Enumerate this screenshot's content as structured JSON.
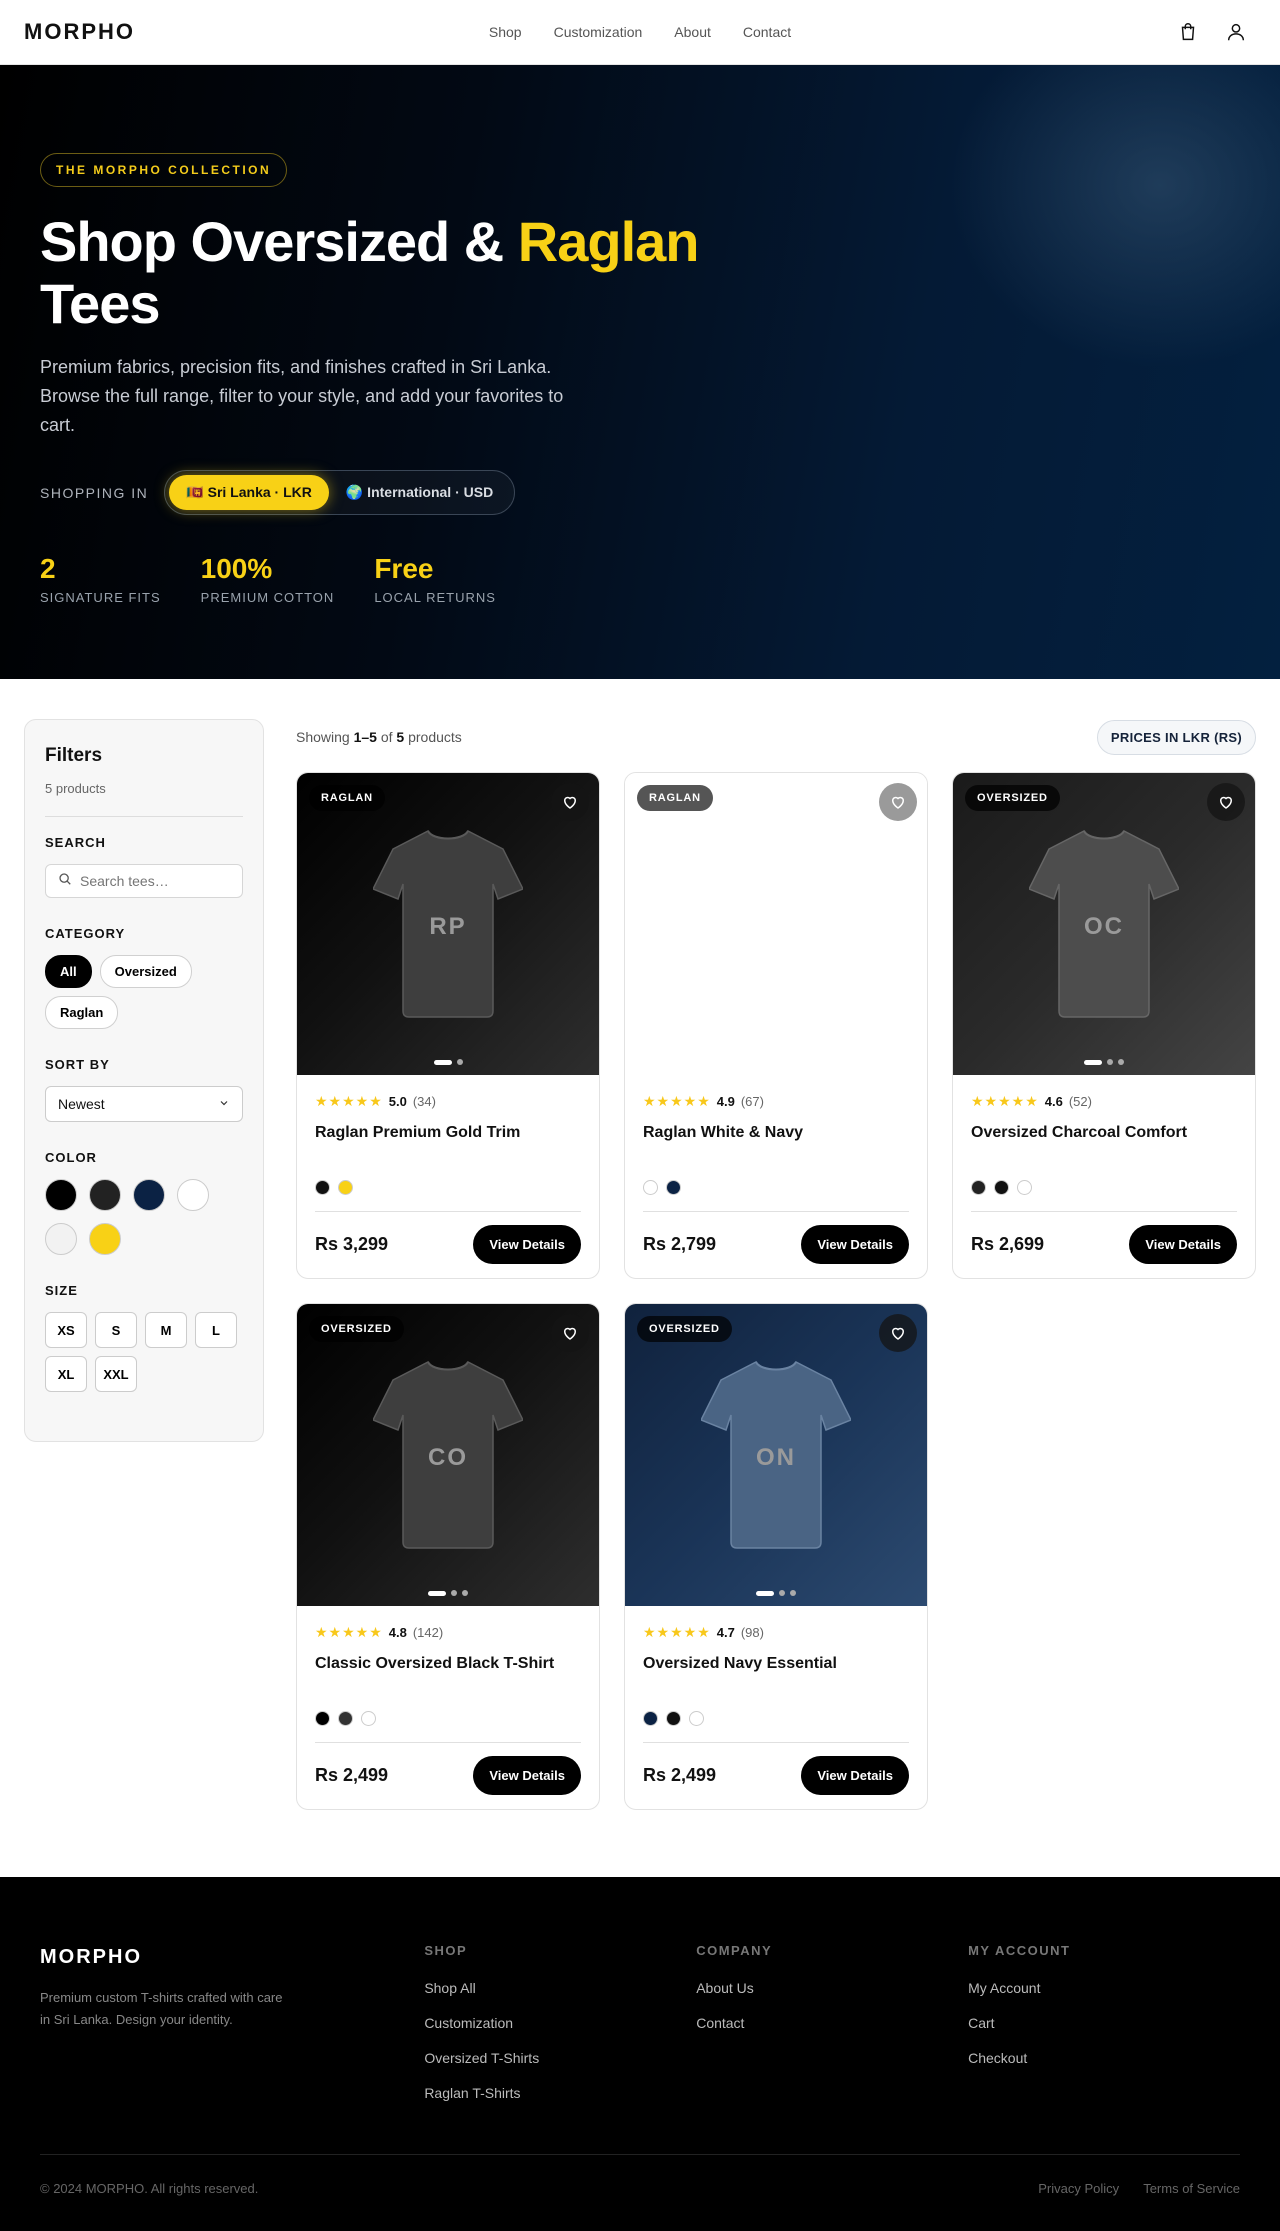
{
  "nav": {
    "logo": "MORPHO",
    "links": [
      "Shop",
      "Customization",
      "About",
      "Contact"
    ],
    "icons": [
      "cart-icon",
      "user-icon"
    ]
  },
  "hero": {
    "pill": "THE MORPHO COLLECTION",
    "title_line1": "Shop Oversized & ",
    "title_highlight": "Raglan",
    "title_line2": "Tees",
    "description": "Premium fabrics, precision fits, and finishes crafted in Sri Lanka. Browse the full range, filter to your style, and add your favorites to cart.",
    "shopping_in_label": "SHOPPING IN",
    "region_options": [
      "🇱🇰 Sri Lanka · LKR",
      "🌍 International · USD"
    ],
    "region_selected": "🇱🇰 Sri Lanka · LKR",
    "stats": [
      {
        "value": "2",
        "label": "SIGNATURE FITS"
      },
      {
        "value": "100%",
        "label": "PREMIUM COTTON"
      },
      {
        "value": "Free",
        "label": "LOCAL RETURNS"
      }
    ],
    "accent_color": "#f8d116"
  },
  "filters": {
    "title": "Filters",
    "count_text": "5 products",
    "search_label": "SEARCH",
    "search_placeholder": "Search tees…",
    "category_label": "CATEGORY",
    "categories": [
      "All",
      "Oversized",
      "Raglan"
    ],
    "category_selected": "All",
    "sort_label": "SORT BY",
    "sort_value": "Newest",
    "color_label": "COLOR",
    "colors": [
      "#000000",
      "#222222",
      "#0b2244",
      "#ffffff",
      "#f2f2f2",
      "#f8d116"
    ],
    "size_label": "SIZE",
    "sizes": [
      "XS",
      "S",
      "M",
      "L",
      "XL",
      "XXL"
    ]
  },
  "results": {
    "showing_prefix": "Showing ",
    "range": "1–5",
    "of": " of ",
    "total": "5",
    "suffix": " products",
    "price_badge": "PRICES IN LKR (RS)"
  },
  "products": [
    {
      "badge": "RAGLAN",
      "initials": "RP",
      "rating": "5.0",
      "reviews": "(34)",
      "name": "Raglan Premium Gold Trim",
      "colors": [
        "#111111",
        "#f8d116"
      ],
      "price": "Rs 3,299",
      "button": "View Details",
      "bg": "dark",
      "images": 2
    },
    {
      "badge": "RAGLAN",
      "initials": "",
      "rating": "4.9",
      "reviews": "(67)",
      "name": "Raglan White & Navy",
      "colors": [
        "#ffffff",
        "#0b2244"
      ],
      "price": "Rs 2,799",
      "button": "View Details",
      "bg": "white",
      "images": 0
    },
    {
      "badge": "OVERSIZED",
      "initials": "OC",
      "rating": "4.6",
      "reviews": "(52)",
      "name": "Oversized Charcoal Comfort",
      "colors": [
        "#222222",
        "#111111",
        "#ffffff"
      ],
      "price": "Rs 2,699",
      "button": "View Details",
      "bg": "charcoal",
      "images": 3
    },
    {
      "badge": "OVERSIZED",
      "initials": "CO",
      "rating": "4.8",
      "reviews": "(142)",
      "name": "Classic Oversized Black T-Shirt",
      "colors": [
        "#000000",
        "#333333",
        "#ffffff"
      ],
      "price": "Rs 2,499",
      "button": "View Details",
      "bg": "dark",
      "images": 3
    },
    {
      "badge": "OVERSIZED",
      "initials": "ON",
      "rating": "4.7",
      "reviews": "(98)",
      "name": "Oversized Navy Essential",
      "colors": [
        "#0b2244",
        "#111111",
        "#ffffff"
      ],
      "price": "Rs 2,499",
      "button": "View Details",
      "bg": "navy",
      "images": 3
    }
  ],
  "footer": {
    "logo": "MORPHO",
    "tagline": "Premium custom T-shirts crafted with care in Sri Lanka. Design your identity.",
    "cols": [
      {
        "title": "SHOP",
        "links": [
          "Shop All",
          "Customization",
          "Oversized T-Shirts",
          "Raglan T-Shirts"
        ]
      },
      {
        "title": "COMPANY",
        "links": [
          "About Us",
          "Contact"
        ]
      },
      {
        "title": "MY ACCOUNT",
        "links": [
          "My Account",
          "Cart",
          "Checkout"
        ]
      }
    ],
    "copyright": "© 2024 MORPHO. All rights reserved.",
    "legal": [
      "Privacy Policy",
      "Terms of Service"
    ]
  }
}
